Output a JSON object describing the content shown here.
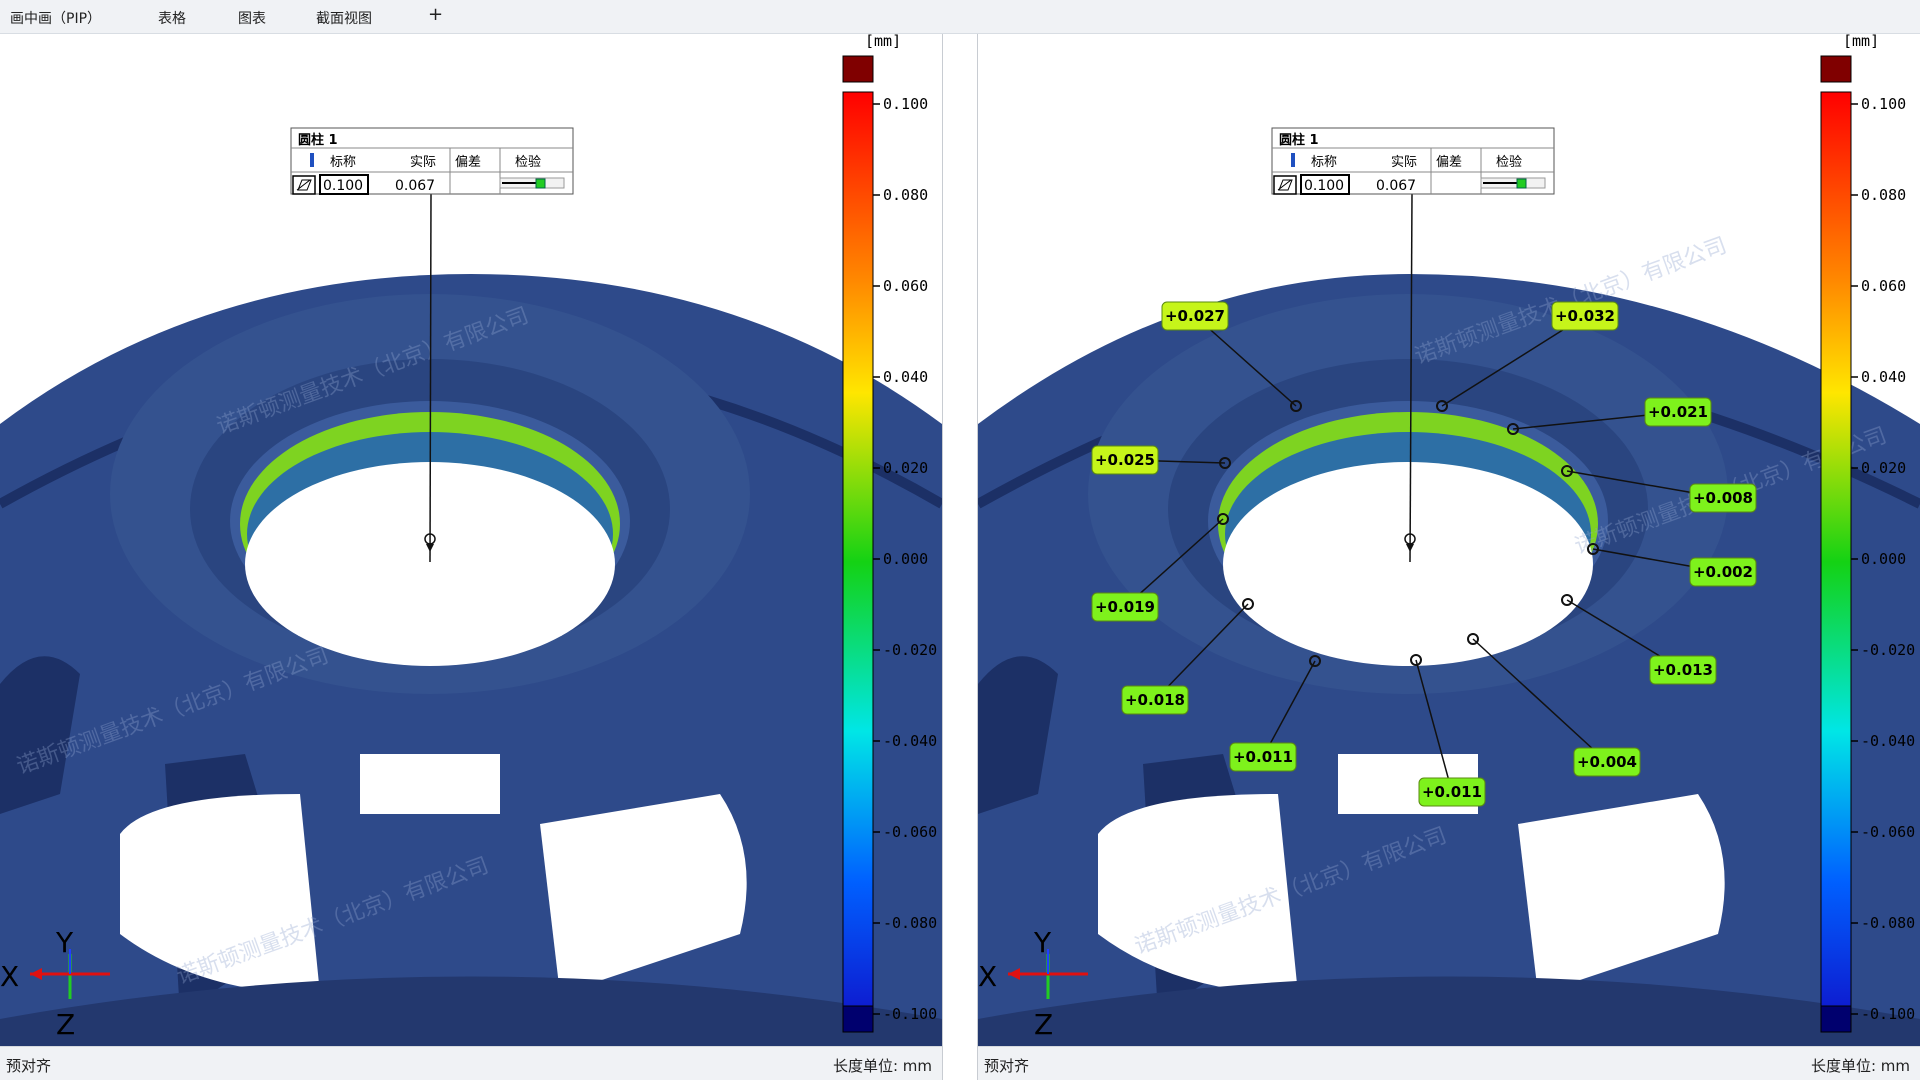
{
  "tabs": [
    "画中画（PIP）",
    "表格",
    "图表",
    "截面视图"
  ],
  "add_tab": "+",
  "colorbar": {
    "unit": "[mm]",
    "ticks": [
      "0.100",
      "0.080",
      "0.060",
      "0.040",
      "0.020",
      "0.000",
      "-0.020",
      "-0.040",
      "-0.060",
      "-0.080",
      "-0.100"
    ]
  },
  "inspection_table": {
    "title": "圆柱 1",
    "headers": [
      "标称",
      "实际",
      "偏差",
      "检验"
    ],
    "nominal": "0.100",
    "actual": "0.067",
    "deviation": ""
  },
  "axes": {
    "x": "X",
    "y": "Y",
    "z": "Z"
  },
  "watermark": "诺斯顿测量技术（北京）有限公司",
  "deviation_labels": [
    "+0.027",
    "+0.032",
    "+0.021",
    "+0.025",
    "+0.008",
    "+0.002",
    "+0.019",
    "+0.013",
    "+0.018",
    "+0.011",
    "+0.004",
    "+0.011"
  ],
  "status": {
    "left": "预对齐",
    "right": "长度单位: mm"
  },
  "colors": {
    "part": "#2f4a8c",
    "label_bg": "#7ef21c",
    "label_bg_yellow": "#c6f51a",
    "background": "#ffffff"
  }
}
